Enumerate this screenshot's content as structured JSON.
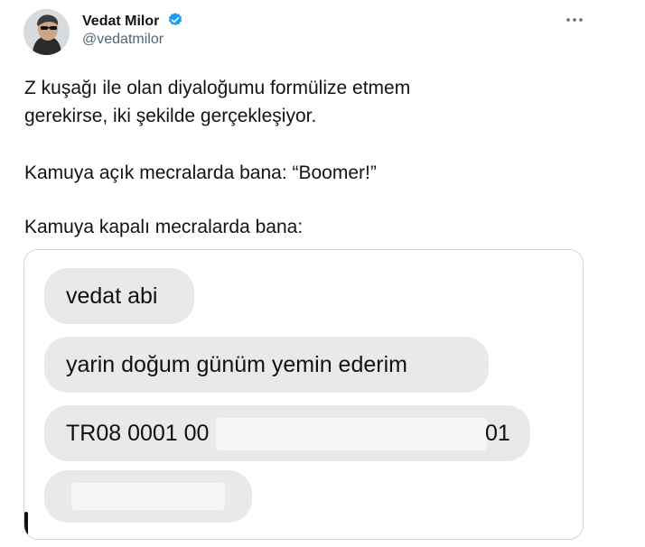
{
  "author": {
    "name": "Vedat Milor",
    "handle": "@vedatmilor",
    "verified": true
  },
  "tweet": {
    "line1": "Z kuşağı ile olan diyaloğumu formülize etmem",
    "line2": "gerekirse, iki şekilde gerçekleşiyor.",
    "line3": "Kamuya açık mecralarda bana: “Boomer!”",
    "line4": "Kamuya kapalı mecralarda bana:"
  },
  "media": {
    "messages": [
      {
        "text": "vedat abi"
      },
      {
        "text": "yarin doğum günüm yemin ederim"
      },
      {
        "text_start": "TR08 0001 00",
        "text_end": "01"
      },
      {
        "text_start": "",
        "text_end": ""
      }
    ]
  },
  "icons": {
    "verified": "verified-badge-icon",
    "more": "more-options-icon"
  },
  "colors": {
    "verified_badge": "#1d9bf0",
    "handle_text": "#536471",
    "bubble_bg": "#e9e9eb",
    "card_border": "#cfd9de"
  }
}
